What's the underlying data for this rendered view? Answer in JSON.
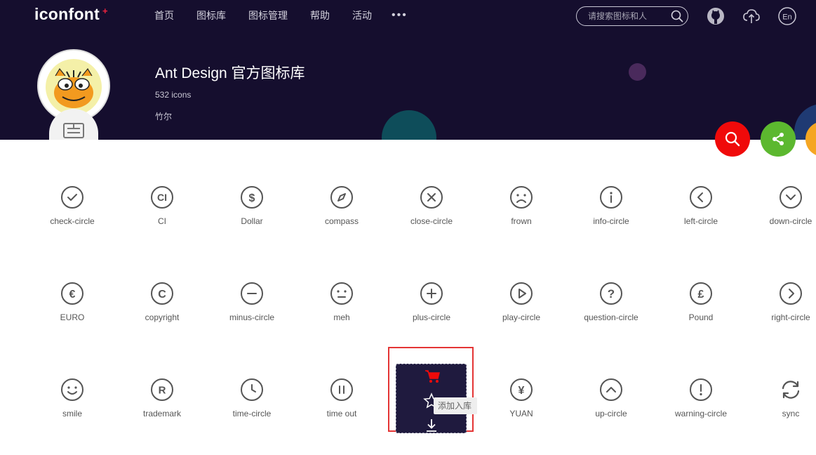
{
  "header": {
    "logo": "iconfont",
    "logo_plus": "+",
    "nav": [
      "首页",
      "图标库",
      "图标管理",
      "帮助",
      "活动"
    ],
    "nav_more": "•••",
    "search_placeholder": "请搜索图标和人"
  },
  "library": {
    "title": "Ant Design 官方图标库",
    "count": "532 icons",
    "author": "竹尔"
  },
  "colors": {
    "header_bg": "#150e2e",
    "fab_search": "#f00a0a",
    "fab_share": "#5cb82f",
    "fab_third": "#f5a623",
    "icon_stroke": "#555555",
    "hover_border": "#e43535"
  },
  "icons": [
    {
      "name": "check-circle",
      "label": "check-circle"
    },
    {
      "name": "ci",
      "label": "CI"
    },
    {
      "name": "dollar",
      "label": "Dollar"
    },
    {
      "name": "compass",
      "label": "compass"
    },
    {
      "name": "close-circle",
      "label": "close-circle"
    },
    {
      "name": "frown",
      "label": "frown"
    },
    {
      "name": "info-circle",
      "label": "info-circle"
    },
    {
      "name": "left-circle",
      "label": "left-circle"
    },
    {
      "name": "down-circle",
      "label": "down-circle"
    },
    {
      "name": "euro",
      "label": "EURO"
    },
    {
      "name": "copyright",
      "label": "copyright"
    },
    {
      "name": "minus-circle",
      "label": "minus-circle"
    },
    {
      "name": "meh",
      "label": "meh"
    },
    {
      "name": "plus-circle",
      "label": "plus-circle"
    },
    {
      "name": "play-circle",
      "label": "play-circle"
    },
    {
      "name": "question-circle",
      "label": "question-circle"
    },
    {
      "name": "pound",
      "label": "Pound"
    },
    {
      "name": "right-circle",
      "label": "right-circle"
    },
    {
      "name": "smile",
      "label": "smile"
    },
    {
      "name": "trademark",
      "label": "trademark"
    },
    {
      "name": "time-circle",
      "label": "time-circle"
    },
    {
      "name": "time-out",
      "label": "time out"
    },
    {
      "name": "hovered",
      "label": ""
    },
    {
      "name": "yuan",
      "label": "YUAN"
    },
    {
      "name": "up-circle",
      "label": "up-circle"
    },
    {
      "name": "warning-circle",
      "label": "warning-circle"
    },
    {
      "name": "sync",
      "label": "sync"
    }
  ],
  "hover_card": {
    "tooltip": "添加入库"
  }
}
